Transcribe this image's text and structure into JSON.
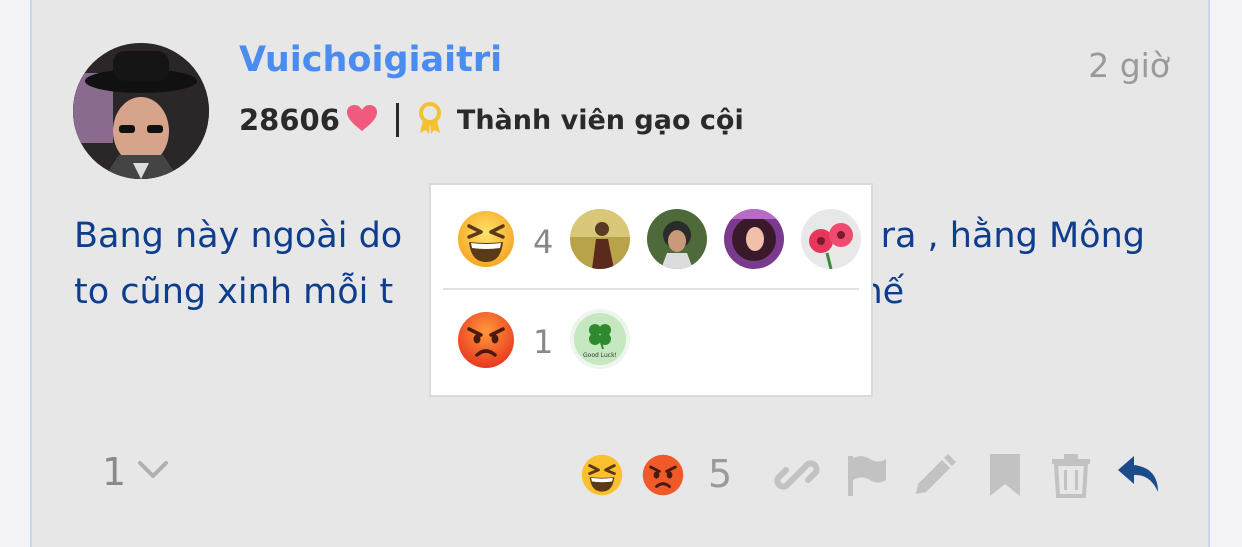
{
  "post": {
    "username": "Vuichoigiaitri",
    "time": "2 giờ",
    "points": "28606",
    "rank_title": "Thành viên gạo cội",
    "content": "Bang này ngoài do                                           ra , hằng Mông\nto cũng xinh mỗi t                                          hế"
  },
  "reactions_popup": {
    "rows": [
      {
        "emoji": "grinning-squinting-face",
        "count": "4",
        "reactors": [
          "avatar-girl-dress",
          "avatar-man-hat",
          "avatar-woman-curly-hair",
          "avatar-pink-flowers"
        ]
      },
      {
        "emoji": "angry-face",
        "count": "1",
        "reactors": [
          "avatar-good-luck-clover"
        ]
      }
    ],
    "good_luck_text": "Good Luck!"
  },
  "footer": {
    "reply_count": "1",
    "reaction_total": "5",
    "actions": [
      "link-icon",
      "flag-icon",
      "edit-icon",
      "bookmark-icon",
      "trash-icon",
      "reply-icon"
    ]
  },
  "colors": {
    "username": "#4a8cf0",
    "content_text": "#0d3d8c",
    "heart": "#f05a7e",
    "medal": "#f2c230",
    "reply_icon": "#1c4b8c",
    "inactive_icon": "#c2c2c2"
  }
}
